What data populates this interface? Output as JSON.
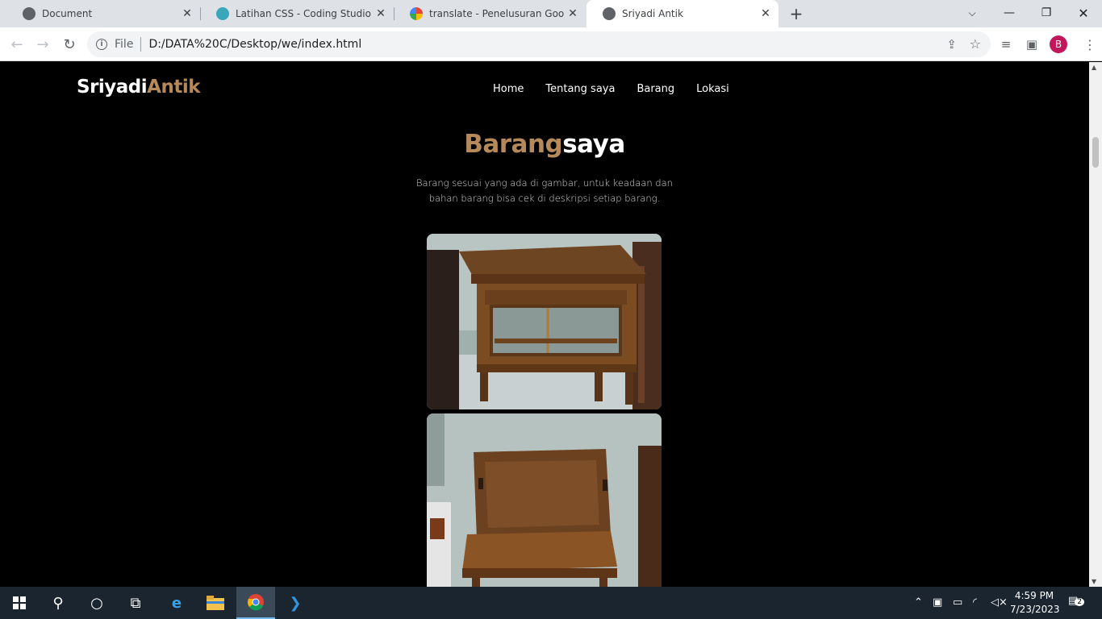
{
  "browser": {
    "tabs": [
      {
        "title": "Document",
        "icon": "globe-icon",
        "active": false
      },
      {
        "title": "Latihan CSS - Coding Studio",
        "icon": "coding-studio-icon",
        "active": false
      },
      {
        "title": "translate - Penelusuran Google",
        "icon": "google-icon",
        "active": false
      },
      {
        "title": "Sriyadi Antik",
        "icon": "globe-icon",
        "active": true
      }
    ],
    "address_prefix": "File",
    "url": "D:/DATA%20C/Desktop/we/index.html",
    "profile_initial": "B"
  },
  "site": {
    "logo_part1": "Sriyadi",
    "logo_part2": "Antik",
    "nav": [
      "Home",
      "Tentang saya",
      "Barang",
      "Lokasi"
    ],
    "section_title_part1": "Barang",
    "section_title_part2": "saya",
    "section_desc": "Barang sesuai yang ada di gambar, untuk keadaan dan bahan barang bisa cek di deskripsi setiap barang."
  },
  "taskbar": {
    "time": "4:59 PM",
    "date": "7/23/2023",
    "notification_count": "2"
  },
  "colors": {
    "accent": "#b6895b",
    "page_bg": "#000000",
    "tabstrip_bg": "#dee1e6",
    "taskbar_bg": "#1b2530"
  }
}
